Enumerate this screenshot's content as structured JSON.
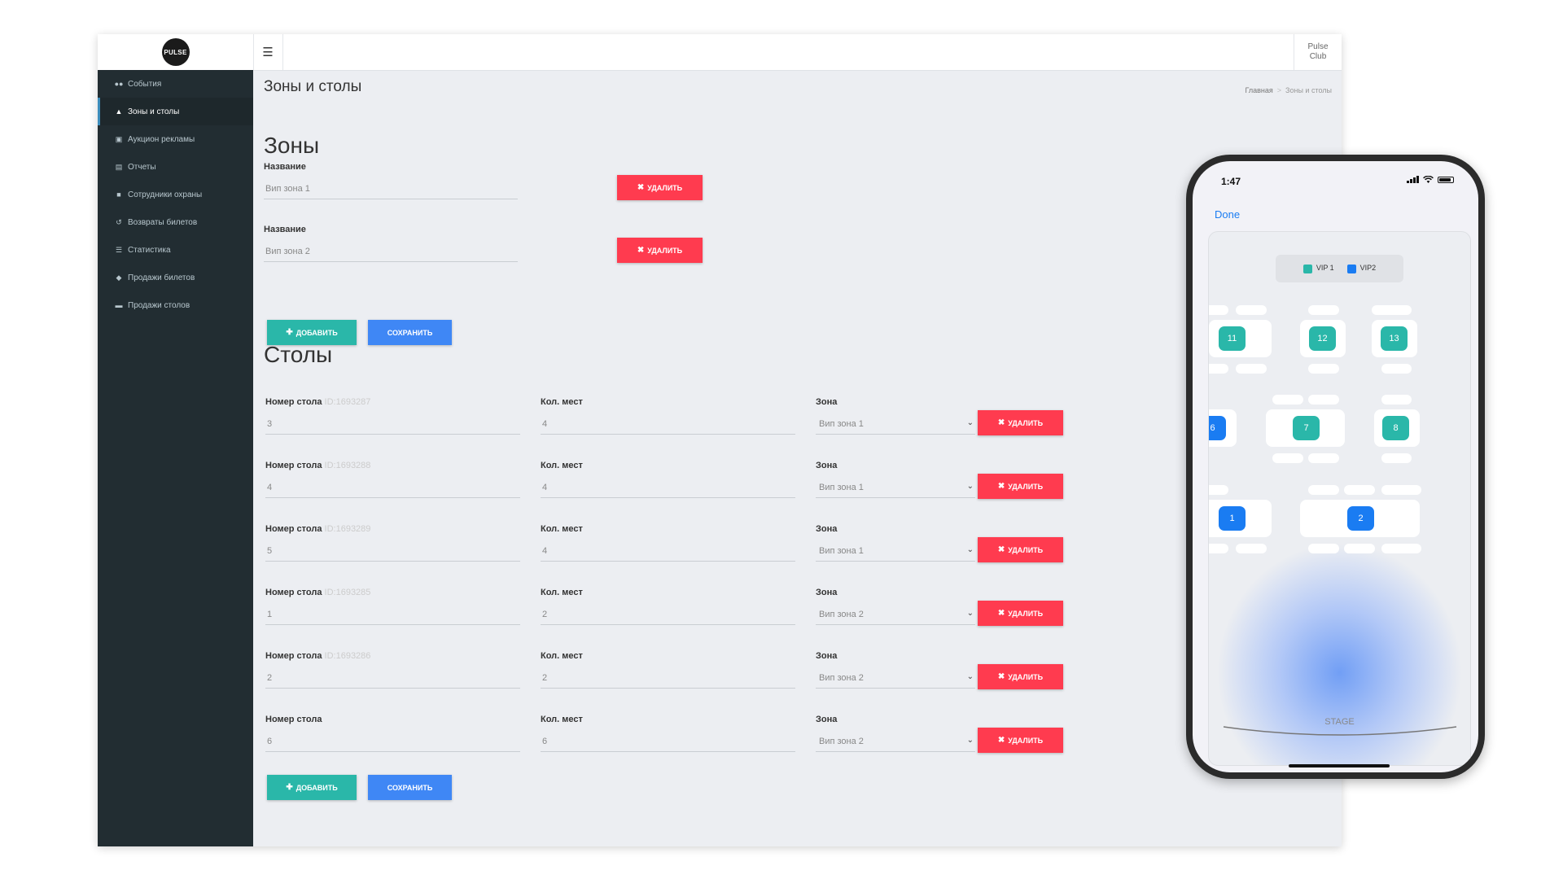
{
  "topbar": {
    "logo_text": "PULSE",
    "club_name": "Pulse Club"
  },
  "sidebar": {
    "items": [
      {
        "label": "События",
        "icon": "users-icon",
        "active": false
      },
      {
        "label": "Зоны и столы",
        "icon": "sitemap-icon",
        "active": true
      },
      {
        "label": "Аукцион рекламы",
        "icon": "money-icon",
        "active": false
      },
      {
        "label": "Отчеты",
        "icon": "file-icon",
        "active": false
      },
      {
        "label": "Сотрудники охраны",
        "icon": "lock-icon",
        "active": false
      },
      {
        "label": "Возвраты билетов",
        "icon": "undo-icon",
        "active": false
      },
      {
        "label": "Статистика",
        "icon": "list-icon",
        "active": false
      },
      {
        "label": "Продажи билетов",
        "icon": "ticket-icon",
        "active": false
      },
      {
        "label": "Продажи столов",
        "icon": "folder-icon",
        "active": false
      }
    ]
  },
  "page": {
    "title": "Зоны и столы",
    "breadcrumb": {
      "home": "Главная",
      "separator": ">",
      "current": "Зоны и столы"
    }
  },
  "zones": {
    "heading": "Зоны",
    "name_label": "Название",
    "items": [
      {
        "value": "Вип зона 1"
      },
      {
        "value": "Вип зона 2"
      }
    ],
    "delete_label": "удалить",
    "add_label": "добавить",
    "save_label": "сохранить"
  },
  "tables": {
    "heading": "Столы",
    "number_label": "Номер стола",
    "seats_label": "Кол. мест",
    "zone_label": "Зона",
    "delete_label": "удалить",
    "add_label": "добавить",
    "save_label": "сохранить",
    "rows": [
      {
        "id": "ID:1693287",
        "number": "3",
        "seats": "4",
        "zone": "Вип зона 1"
      },
      {
        "id": "ID:1693288",
        "number": "4",
        "seats": "4",
        "zone": "Вип зона 1"
      },
      {
        "id": "ID:1693289",
        "number": "5",
        "seats": "4",
        "zone": "Вип зона 1"
      },
      {
        "id": "ID:1693285",
        "number": "1",
        "seats": "2",
        "zone": "Вип зона 2"
      },
      {
        "id": "ID:1693286",
        "number": "2",
        "seats": "2",
        "zone": "Вип зона 2"
      },
      {
        "id": "",
        "number": "6",
        "seats": "6",
        "zone": "Вип зона 2"
      }
    ]
  },
  "phone": {
    "time": "1:47",
    "done_label": "Done",
    "legend": [
      {
        "label": "VIP 1",
        "color": "#2ab7a9"
      },
      {
        "label": "VIP2",
        "color": "#1a7cf2"
      }
    ],
    "tables": [
      "11",
      "12",
      "13",
      "6",
      "7",
      "8",
      "1",
      "2"
    ],
    "stage_label": "STAGE"
  },
  "colors": {
    "sidebar_bg": "#222d32",
    "delete": "#ff3b4f",
    "add": "#2ab7a9",
    "save": "#3f87f5",
    "vip1": "#2ab7a9",
    "vip2": "#1a7cf2"
  }
}
